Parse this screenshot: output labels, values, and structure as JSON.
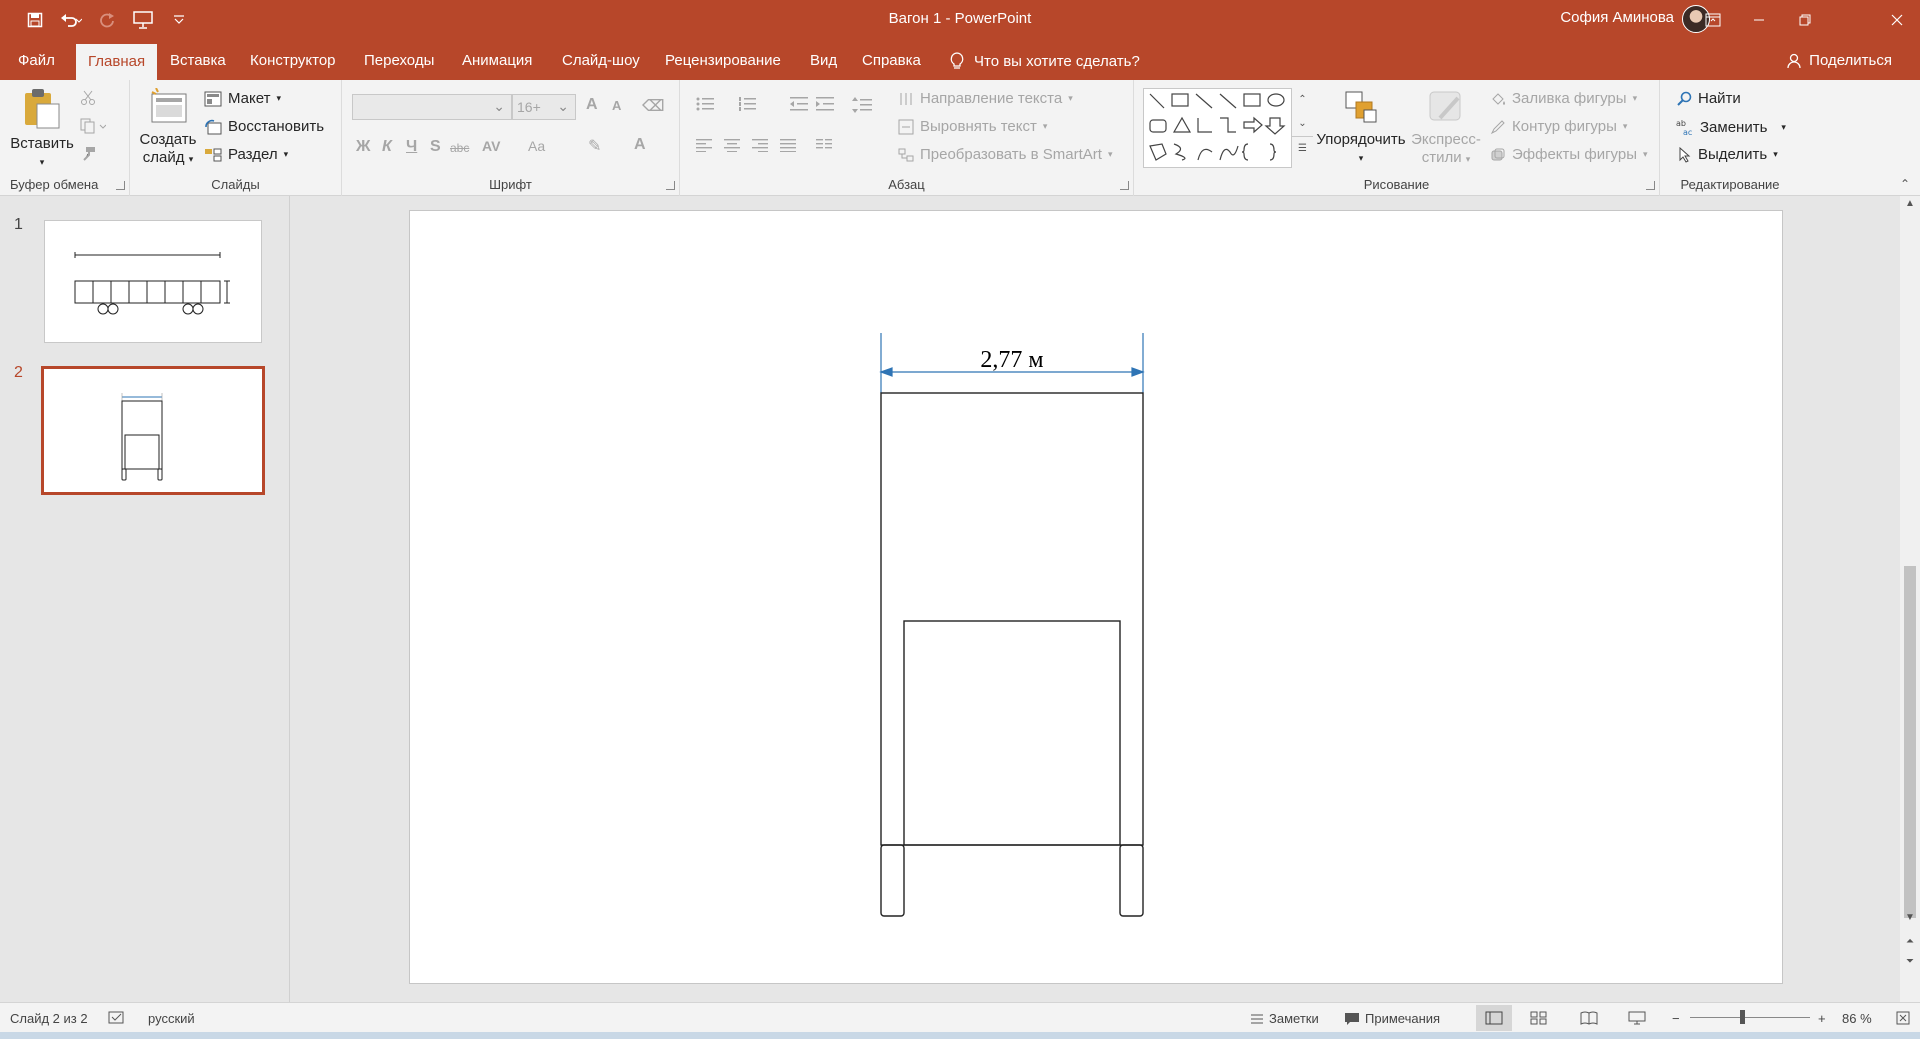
{
  "window": {
    "title": "Вагон 1  -  PowerPoint",
    "user": "София Аминова"
  },
  "tabs": [
    "Файл",
    "Главная",
    "Вставка",
    "Конструктор",
    "Переходы",
    "Анимация",
    "Слайд-шоу",
    "Рецензирование",
    "Вид",
    "Справка"
  ],
  "active_tab": "Главная",
  "tell_me": "Что вы хотите сделать?",
  "share": "Поделиться",
  "ribbon": {
    "clipboard": {
      "label": "Буфер обмена",
      "paste": "Вставить"
    },
    "slides": {
      "label": "Слайды",
      "new_slide_1": "Создать",
      "new_slide_2": "слайд",
      "layout": "Макет",
      "reset": "Восстановить",
      "section": "Раздел"
    },
    "font": {
      "label": "Шрифт",
      "size": "16+",
      "bold": "Ж",
      "italic": "К",
      "underline": "Ч",
      "shadow": "S",
      "strike": "abc",
      "spacing": "AV",
      "case": "Aa",
      "color": "A",
      "grow": "A",
      "shrink": "A"
    },
    "paragraph": {
      "label": "Абзац",
      "text_direction": "Направление текста",
      "align_text": "Выровнять текст",
      "smartart": "Преобразовать в SmartArt"
    },
    "drawing": {
      "label": "Рисование",
      "arrange": "Упорядочить",
      "quick_styles_1": "Экспресс-",
      "quick_styles_2": "стили",
      "fill": "Заливка фигуры",
      "outline": "Контур фигуры",
      "effects": "Эффекты фигуры"
    },
    "editing": {
      "label": "Редактирование",
      "find": "Найти",
      "replace": "Заменить",
      "select": "Выделить"
    }
  },
  "slides": [
    {
      "number": "1"
    },
    {
      "number": "2"
    }
  ],
  "slide": {
    "dimension_label": "2,77 м"
  },
  "status": {
    "slide_of": "Слайд 2 из 2",
    "language": "русский",
    "notes": "Заметки",
    "comments": "Примечания",
    "zoom": "86 %",
    "zoom_level": 0.86
  },
  "colors": {
    "accent": "#b7472a",
    "dimension_line": "#2e74b5"
  }
}
